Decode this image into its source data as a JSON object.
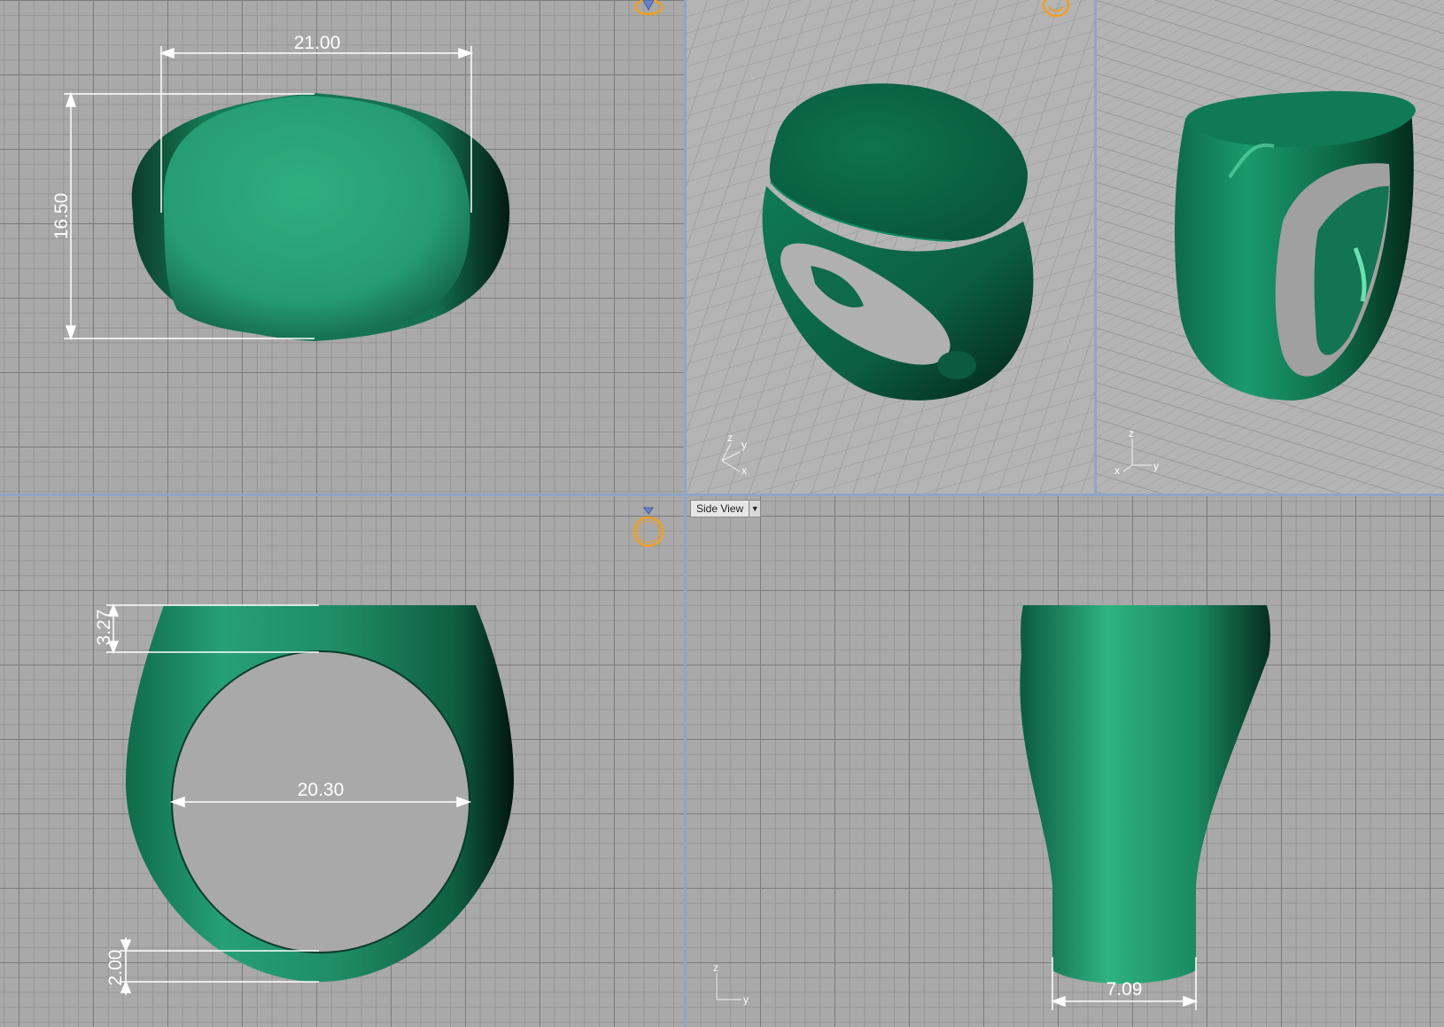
{
  "viewports": {
    "top": {
      "dimension_width": "21.00",
      "dimension_height": "16.50"
    },
    "perspective_left": {
      "axis_labels": [
        "z",
        "y",
        "x"
      ]
    },
    "perspective_right": {
      "axis_labels": [
        "z",
        "x",
        "y"
      ]
    },
    "front": {
      "dimension_top_thickness": "3.27",
      "dimension_inner_diameter": "20.30",
      "dimension_bottom_thickness": "2.00"
    },
    "side": {
      "view_label": "Side View",
      "dimension_bottom_width": "7.09",
      "axis_labels": [
        "z",
        "y"
      ]
    }
  },
  "icons": {
    "ring_gem_icon": "ring-with-gem-icon",
    "ring_icon": "ring-icon",
    "dropdown_icon": "dropdown-arrow-icon"
  },
  "colors": {
    "model_green": "#22936c",
    "viewport_border": "#8da6c9",
    "icon_orange": "#f0a020",
    "dimension_line": "#ffffff"
  }
}
